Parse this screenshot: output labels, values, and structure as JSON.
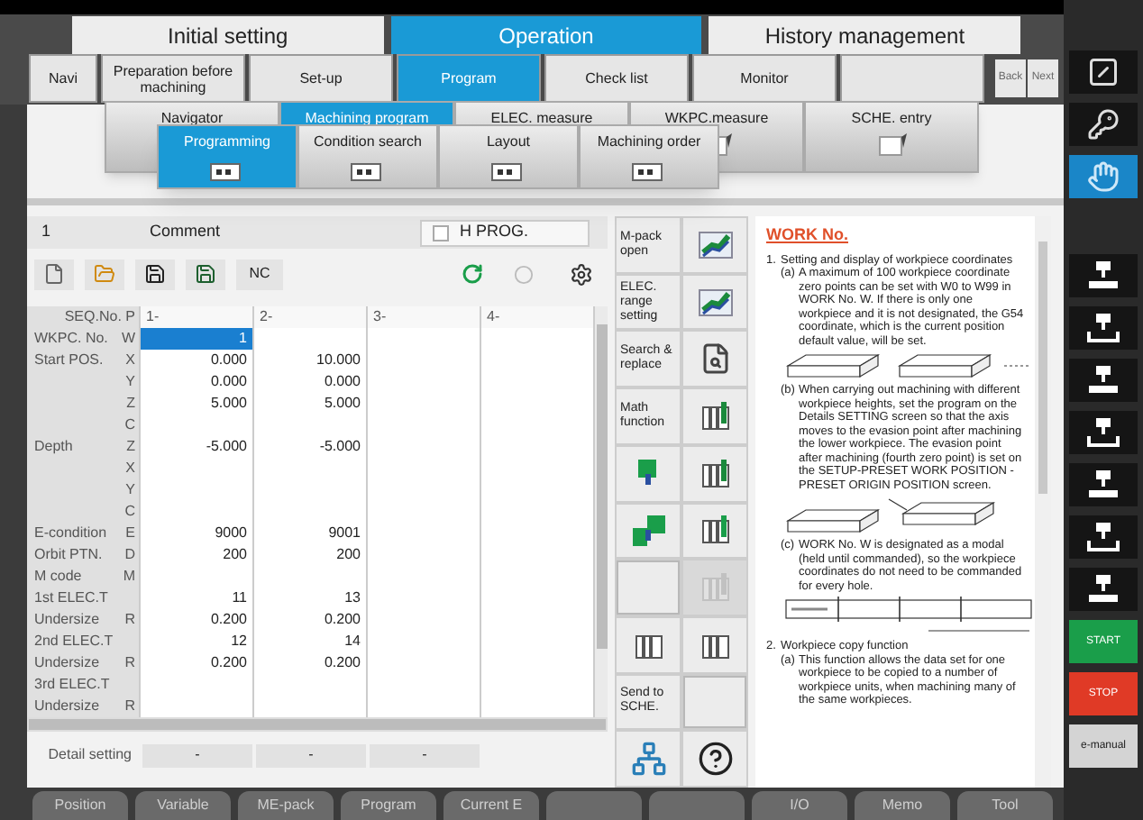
{
  "top_tabs": [
    {
      "label": "Initial setting",
      "selected": false
    },
    {
      "label": "Operation",
      "selected": true
    },
    {
      "label": "History management",
      "selected": false
    }
  ],
  "nav_tabs": [
    {
      "label": "Navi",
      "selected": false
    },
    {
      "label": "Preparation before machining",
      "selected": false
    },
    {
      "label": "Set-up",
      "selected": false
    },
    {
      "label": "Program",
      "selected": true
    },
    {
      "label": "Check list",
      "selected": false
    },
    {
      "label": "Monitor",
      "selected": false
    }
  ],
  "page_buttons": [
    {
      "label": "Back",
      "disabled": true
    },
    {
      "label": "Next",
      "disabled": true
    }
  ],
  "sub_tabs": [
    {
      "label": "Navigator",
      "selected": false
    },
    {
      "label": "Machining program",
      "selected": true
    },
    {
      "label": "ELEC. measure",
      "selected": false
    },
    {
      "label": "WKPC.measure",
      "selected": false
    },
    {
      "label": "SCHE. entry",
      "selected": false
    }
  ],
  "mode_tabs": [
    {
      "label": "Programming",
      "selected": true
    },
    {
      "label": "Condition search",
      "selected": false
    },
    {
      "label": "Layout",
      "selected": false
    },
    {
      "label": "Machining order",
      "selected": false
    }
  ],
  "program": {
    "number": "1",
    "comment_label": "Comment",
    "h_prog": {
      "label": "H PROG.",
      "checked": false
    },
    "nc_label": "NC"
  },
  "table": {
    "header": {
      "label": "SEQ.No.",
      "axis": "P"
    },
    "columns": [
      "1-",
      "2-",
      "3-",
      "4-"
    ],
    "rows": [
      {
        "label": "WKPC. No.",
        "axis": "W",
        "values": [
          "1"
        ],
        "selected": true
      },
      {
        "label": "Start POS.",
        "axis": "X",
        "values": [
          "0.000",
          "10.000"
        ],
        "selected": false
      },
      {
        "axis": "Y",
        "values": [
          "0.000",
          "0.000"
        ],
        "selected": false
      },
      {
        "axis": "Z",
        "values": [
          "5.000",
          "5.000"
        ],
        "selected": false
      },
      {
        "axis": "C",
        "selected": false
      },
      {
        "label": "Depth",
        "axis": "Z",
        "values": [
          "-5.000",
          "-5.000"
        ],
        "selected": false
      },
      {
        "axis": "X",
        "selected": false
      },
      {
        "axis": "Y",
        "selected": false
      },
      {
        "axis": "C",
        "selected": false
      },
      {
        "label": "E-condition",
        "axis": "E",
        "values": [
          "9000",
          "9001"
        ],
        "selected": false
      },
      {
        "label": "Orbit PTN.",
        "axis": "D",
        "values": [
          "200",
          "200"
        ],
        "selected": false
      },
      {
        "label": "M code",
        "axis": "M",
        "selected": false
      },
      {
        "label": "1st ELEC.T",
        "values": [
          "11",
          "13"
        ],
        "selected": false
      },
      {
        "label": "Undersize",
        "axis": "R",
        "values": [
          "0.200",
          "0.200"
        ],
        "selected": false
      },
      {
        "label": "2nd ELEC.T",
        "values": [
          "12",
          "14"
        ],
        "selected": false
      },
      {
        "label": "Undersize",
        "axis": "R",
        "values": [
          "0.200",
          "0.200"
        ],
        "selected": false
      },
      {
        "label": "3rd ELEC.T",
        "selected": false
      },
      {
        "label": "Undersize",
        "axis": "R",
        "selected": false
      }
    ]
  },
  "detail": {
    "label": "Detail setting",
    "buttons": [
      "-",
      "-",
      "-"
    ]
  },
  "tools": [
    {
      "kind": "text",
      "label": "M-pack open",
      "disabled": false
    },
    {
      "kind": "icon",
      "disabled": false
    },
    {
      "kind": "text",
      "label": "ELEC. range setting",
      "disabled": false
    },
    {
      "kind": "icon",
      "disabled": false
    },
    {
      "kind": "text",
      "label": "Search & replace",
      "disabled": false
    },
    {
      "kind": "icon",
      "disabled": false
    },
    {
      "kind": "text",
      "label": "Math function",
      "disabled": false
    },
    {
      "kind": "icon",
      "disabled": false
    },
    {
      "kind": "icon",
      "disabled": false
    },
    {
      "kind": "icon",
      "disabled": false
    },
    {
      "kind": "icon",
      "disabled": false
    },
    {
      "kind": "icon",
      "disabled": false
    },
    {
      "kind": "blank",
      "disabled": false
    },
    {
      "kind": "icon",
      "disabled": true
    },
    {
      "kind": "icon",
      "disabled": false
    },
    {
      "kind": "icon",
      "disabled": false
    },
    {
      "kind": "text",
      "label": "Send to SCHE.",
      "disabled": false
    },
    {
      "kind": "blank",
      "disabled": false
    },
    {
      "kind": "icon",
      "disabled": false
    },
    {
      "kind": "icon",
      "disabled": false
    }
  ],
  "manual": {
    "title": "WORK No.",
    "blocks": [
      {
        "kind": "heading",
        "marker": "1.",
        "text": "Setting and display of workpiece coordinates"
      },
      {
        "kind": "item",
        "marker": "(a)",
        "text": "A maximum of 100 workpiece coordinate zero points can be set with W0 to W99 in WORK No. W. If there is only one workpiece and it is not designated, the G54 coordinate, which is the current position default value, will be set."
      },
      {
        "kind": "figure_slabs"
      },
      {
        "kind": "item",
        "marker": "(b)",
        "text": "When carrying out machining with different workpiece heights, set the program on the Details SETTING screen so that the axis moves to the evasion point after machining the lower workpiece. The evasion point after machining (fourth zero point) is set on the SETUP-PRESET WORK POSITION - PRESET ORIGIN POSITION screen."
      },
      {
        "kind": "figure_step"
      },
      {
        "kind": "item",
        "marker": "(c)",
        "text": "WORK No. W is designated as a modal (held until commanded), so the workpiece coordinates do not need to be commanded for every hole."
      },
      {
        "kind": "figure_table"
      },
      {
        "kind": "heading",
        "marker": "2.",
        "text": "Workpiece copy function"
      },
      {
        "kind": "item",
        "marker": "(a)",
        "text": "This function allows the data set for one workpiece to be copied to a number of workpiece units, when machining many of the same workpieces."
      }
    ]
  },
  "bottom_tabs": [
    {
      "kind": "text",
      "label": "Position"
    },
    {
      "kind": "text",
      "label": "Variable"
    },
    {
      "kind": "text",
      "label": "ME-pack"
    },
    {
      "kind": "text",
      "label": "Program"
    },
    {
      "kind": "text",
      "label": "Current E"
    },
    {
      "kind": "blank"
    },
    {
      "kind": "blank"
    },
    {
      "kind": "text",
      "label": "I/O"
    },
    {
      "kind": "text",
      "label": "Memo"
    },
    {
      "kind": "text",
      "label": "Tool"
    }
  ],
  "side_buttons": [
    {
      "kind": "icon",
      "selected": false
    },
    {
      "kind": "icon",
      "selected": false
    },
    {
      "kind": "icon",
      "selected": true
    },
    {
      "kind": "icon",
      "selected": false
    },
    {
      "kind": "icon",
      "selected": false
    },
    {
      "kind": "icon",
      "selected": false
    },
    {
      "kind": "icon",
      "selected": false
    },
    {
      "kind": "icon",
      "selected": false
    },
    {
      "kind": "icon",
      "selected": false
    },
    {
      "kind": "icon",
      "selected": false
    },
    {
      "kind": "text",
      "label": "START",
      "color": "#1a9e4a",
      "selected": false
    },
    {
      "kind": "text",
      "label": "STOP",
      "color": "#e03a26",
      "selected": false
    },
    {
      "kind": "text",
      "label": "e-manual",
      "color": "#d4d4d4",
      "selected": false
    }
  ]
}
